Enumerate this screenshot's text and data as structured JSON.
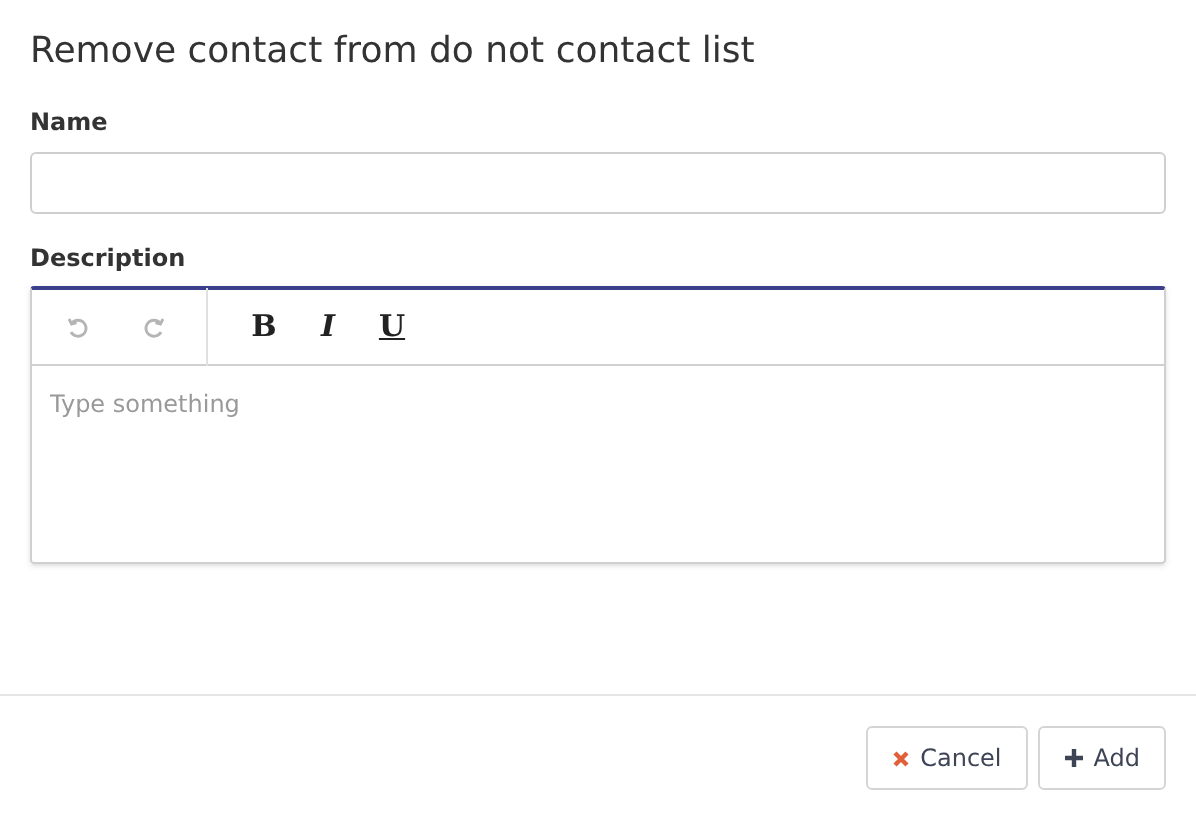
{
  "dialog": {
    "title": "Remove contact from do not contact list"
  },
  "fields": [
    {
      "label": "Name"
    }
  ],
  "description": {
    "label": "Description",
    "placeholder": "Type something",
    "toolbar": [
      {
        "kind": "undo",
        "disabled": true
      },
      {
        "kind": "redo",
        "disabled": true
      },
      {
        "kind": "bold",
        "text": "B"
      },
      {
        "kind": "italic",
        "text": "I"
      },
      {
        "kind": "underline",
        "text": "U"
      }
    ]
  },
  "buttons": [
    {
      "kind": "cancel",
      "label": "Cancel"
    },
    {
      "kind": "add",
      "label": "Add"
    }
  ]
}
